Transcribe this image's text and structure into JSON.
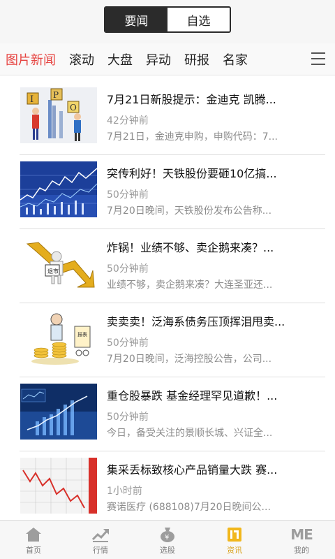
{
  "header": {
    "tabs": [
      {
        "label": "要闻",
        "active": true
      },
      {
        "label": "自选",
        "active": false
      }
    ]
  },
  "categories": {
    "items": [
      "图片新闻",
      "滚动",
      "大盘",
      "异动",
      "研报",
      "名家"
    ],
    "active_color": "#e64340"
  },
  "news": [
    {
      "title": "7月21日新股提示：金迪克 凯腾...",
      "time": "42分钟前",
      "summary": "7月21日，金迪克申购，申购代码：7...",
      "image": "ipo-figures-image"
    },
    {
      "title": "突传利好！天铁股份要砸10亿搞...",
      "time": "50分钟前",
      "summary": "7月20日晚间，天铁股份发布公告称...",
      "image": "stock-chart-image"
    },
    {
      "title": "炸锅！业绩不够、卖企鹅来凑？...",
      "time": "50分钟前",
      "summary": "业绩不够，卖企鹅来凑？大连圣亚还...",
      "image": "delisting-arrow-image"
    },
    {
      "title": "卖卖卖！泛海系债务压顶挥泪甩卖...",
      "time": "50分钟前",
      "summary": "7月20日晚间，泛海控股公告，公司...",
      "image": "coins-cartoon-image"
    },
    {
      "title": "重仓股暴跌 基金经理罕见道歉！...",
      "time": "50分钟前",
      "summary": "今日，备受关注的景顺长城、兴证全...",
      "image": "blue-graph-image"
    },
    {
      "title": "集采丢标致核心产品销量大跌 赛...",
      "time": "1小时前",
      "summary": "赛诺医疗 (688108)7月20日晚间公...",
      "image": "falling-line-image"
    }
  ],
  "tabbar": {
    "items": [
      {
        "label": "首页",
        "icon": "home-icon"
      },
      {
        "label": "行情",
        "icon": "trend-icon"
      },
      {
        "label": "选股",
        "icon": "money-bag-icon"
      },
      {
        "label": "资讯",
        "icon": "news-icon",
        "active": true
      },
      {
        "label": "我的",
        "icon": "me-icon",
        "icon_text": "ME"
      }
    ],
    "active_color": "#d9a21b"
  }
}
